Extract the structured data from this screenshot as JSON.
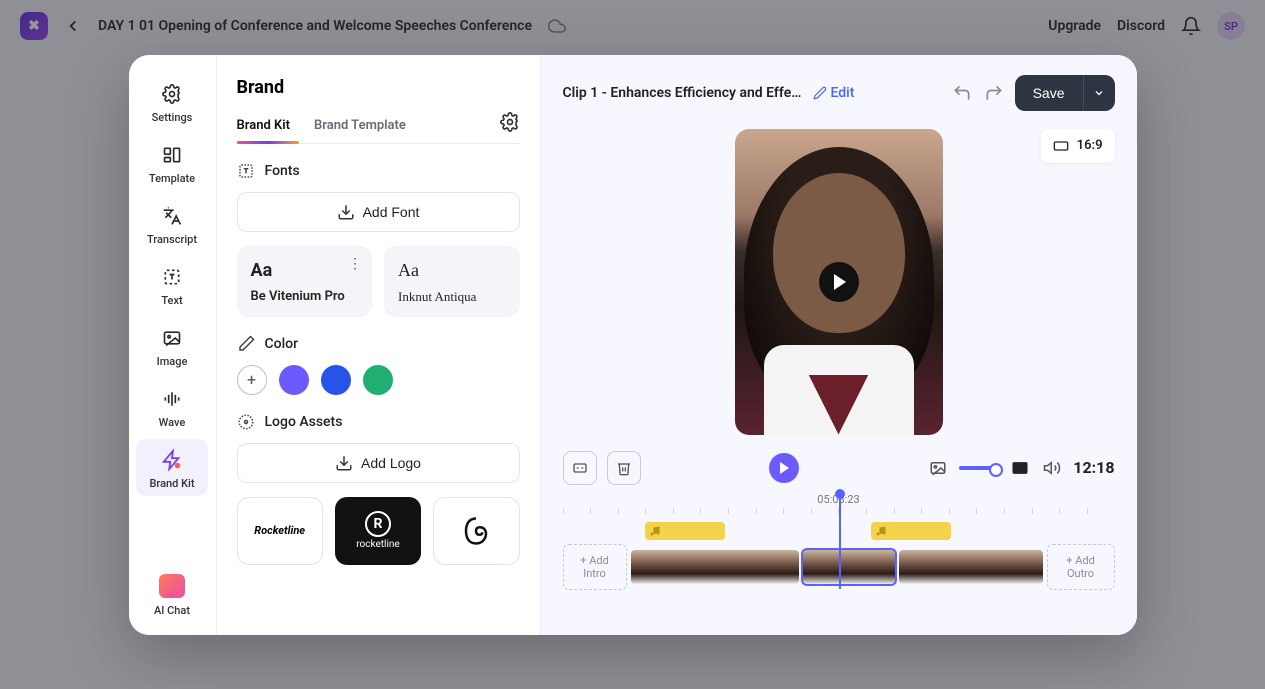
{
  "topbar": {
    "title": "DAY 1 01 Opening of Conference and Welcome Speeches Conference",
    "upgrade": "Upgrade",
    "discord": "Discord",
    "avatar": "SP"
  },
  "vnav": {
    "settings": "Settings",
    "template": "Template",
    "transcript": "Transcript",
    "text": "Text",
    "image": "Image",
    "wave": "Wave",
    "brandkit": "Brand Kit",
    "aichat": "AI Chat"
  },
  "brand": {
    "heading": "Brand",
    "tabs": {
      "kit": "Brand Kit",
      "template": "Brand Template"
    },
    "fonts": {
      "label": "Fonts",
      "add": "Add Font",
      "card1_aa": "Aa",
      "card1_name": "Be Vitenium Pro",
      "card2_aa": "Aa",
      "card2_name": "Inknut Antiqua"
    },
    "color": {
      "label": "Color",
      "swatches": [
        "#6b5bff",
        "#2653e8",
        "#1faf70"
      ]
    },
    "logos": {
      "label": "Logo Assets",
      "add": "Add Logo",
      "logo1": "Rocketline",
      "logo2": "rocketline"
    }
  },
  "preview": {
    "clip_name": "Clip 1 - Enhances Efficiency and Effe...",
    "edit": "Edit",
    "save": "Save",
    "aspect": "16:9",
    "duration": "12:18",
    "timecode": "05:08:23",
    "add_intro": "+ Add Intro",
    "add_outro": "+ Add Outro"
  }
}
